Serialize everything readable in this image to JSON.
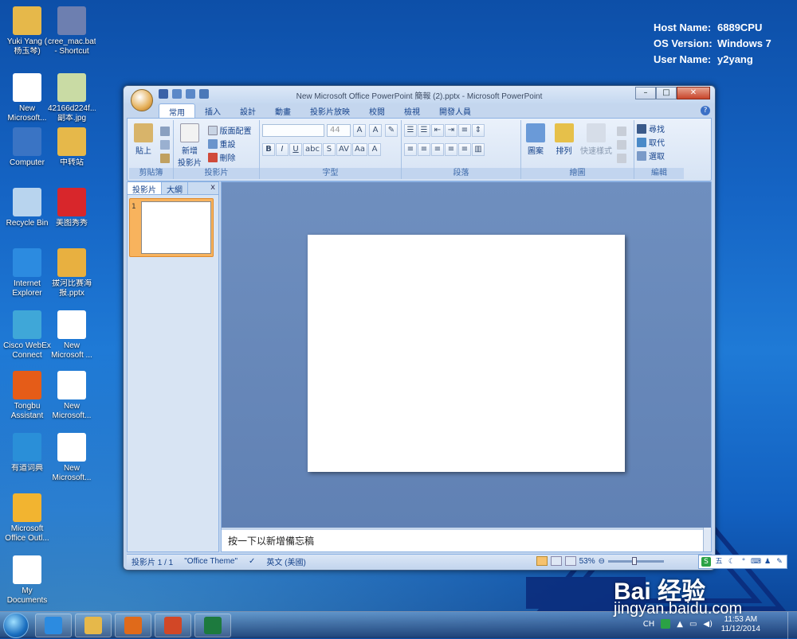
{
  "system_info": [
    {
      "key": "Host Name:",
      "value": "6889CPU"
    },
    {
      "key": "OS Version:",
      "value": "Windows 7"
    },
    {
      "key": "User Name:",
      "value": "y2yang"
    }
  ],
  "desktop_icons": [
    {
      "label1": "Yuki Yang (",
      "label2": "杨玉琴)",
      "icon": "user-folder-icon",
      "color": "#e6b84a"
    },
    {
      "label1": "cree_mac.bat",
      "label2": "- Shortcut",
      "icon": "batch-file-icon",
      "color": "#6d7fb0"
    },
    {
      "label1": "New",
      "label2": "Microsoft...",
      "icon": "powerpoint-file-icon",
      "color": "#ffffff"
    },
    {
      "label1": "42166d224f...",
      "label2": "副本.jpg",
      "icon": "image-file-icon",
      "color": "#c9dba4"
    },
    {
      "label1": "Computer",
      "label2": "",
      "icon": "computer-icon",
      "color": "#3a74c4"
    },
    {
      "label1": "中转站",
      "label2": "",
      "icon": "folder-icon",
      "color": "#e6b84a"
    },
    {
      "label1": "Recycle Bin",
      "label2": "",
      "icon": "recycle-bin-icon",
      "color": "#b8d4ee"
    },
    {
      "label1": "美图秀秀",
      "label2": "",
      "icon": "meitu-app-icon",
      "color": "#d8262b"
    },
    {
      "label1": "Internet",
      "label2": "Explorer",
      "icon": "internet-explorer-icon",
      "color": "#2c8be0"
    },
    {
      "label1": "拔河比赛海",
      "label2": "报.pptx",
      "icon": "powerpoint-file-icon",
      "color": "#e8b040"
    },
    {
      "label1": "Cisco WebEx",
      "label2": "Connect",
      "icon": "webex-icon",
      "color": "#3fa7d8"
    },
    {
      "label1": "New",
      "label2": "Microsoft ...",
      "icon": "word-file-icon",
      "color": "#ffffff"
    },
    {
      "label1": "Tongbu",
      "label2": "Assistant",
      "icon": "tongbu-icon",
      "color": "#e55c18"
    },
    {
      "label1": "New",
      "label2": "Microsoft...",
      "icon": "excel-file-icon",
      "color": "#ffffff"
    },
    {
      "label1": "有道词典",
      "label2": "",
      "icon": "youdao-dict-icon",
      "color": "#2a8fd8"
    },
    {
      "label1": "New",
      "label2": "Microsoft...",
      "icon": "powerpoint-file-icon",
      "color": "#ffffff"
    },
    {
      "label1": "Microsoft",
      "label2": "Office Outl...",
      "icon": "outlook-icon",
      "color": "#f2b430"
    },
    {
      "label1": "My",
      "label2": "Documents",
      "icon": "documents-icon",
      "color": "#ffffff"
    }
  ],
  "window": {
    "title": "New Microsoft Office PowerPoint 簡報 (2).pptx - Microsoft PowerPoint",
    "minimize": "–",
    "maximize": "□",
    "close": "✕",
    "help": "?"
  },
  "ribbon_tabs": [
    "常用",
    "插入",
    "設計",
    "動畫",
    "投影片放映",
    "校閱",
    "檢視",
    "開發人員"
  ],
  "ribbon": {
    "paste": "貼上",
    "new_slide_1": "新增",
    "new_slide_2": "投影片",
    "layout": "版面配置",
    "reset": "重設",
    "delete": "刪除",
    "font_size": "44",
    "shapes": "圖案",
    "arrange": "排列",
    "quick_styles": "快速樣式",
    "find": "尋找",
    "replace": "取代",
    "select": "選取",
    "groups": [
      "剪貼簿",
      "投影片",
      "字型",
      "段落",
      "繪圖",
      "編輯"
    ]
  },
  "panel": {
    "tab_slides": "投影片",
    "tab_outline": "大綱",
    "close": "x",
    "slide_number": "1"
  },
  "notes_placeholder": "按一下以新增備忘稿",
  "status": {
    "slide": "投影片 1 / 1",
    "theme": "\"Office Theme\"",
    "language": "英文 (美國)",
    "zoom": "53%"
  },
  "ime_bar": {
    "label": "五"
  },
  "watermark": {
    "brand": "Bai 经验",
    "url": "jingyan.baidu.com"
  },
  "taskbar": {
    "apps": [
      {
        "icon": "internet-explorer-icon",
        "color": "#2c8be0"
      },
      {
        "icon": "file-explorer-icon",
        "color": "#e6b84a"
      },
      {
        "icon": "media-player-icon",
        "color": "#e06a1a"
      },
      {
        "icon": "powerpoint-taskbar-icon",
        "color": "#d24726"
      },
      {
        "icon": "excel-taskbar-icon",
        "color": "#1d7a3e"
      }
    ],
    "lang": "CH",
    "time": "11:53 AM",
    "date": "11/12/2014"
  },
  "colors": {
    "ribbon_text": "#15428b",
    "desktop_blue": "#1564c4",
    "ppt_orange": "#f8b35d"
  }
}
